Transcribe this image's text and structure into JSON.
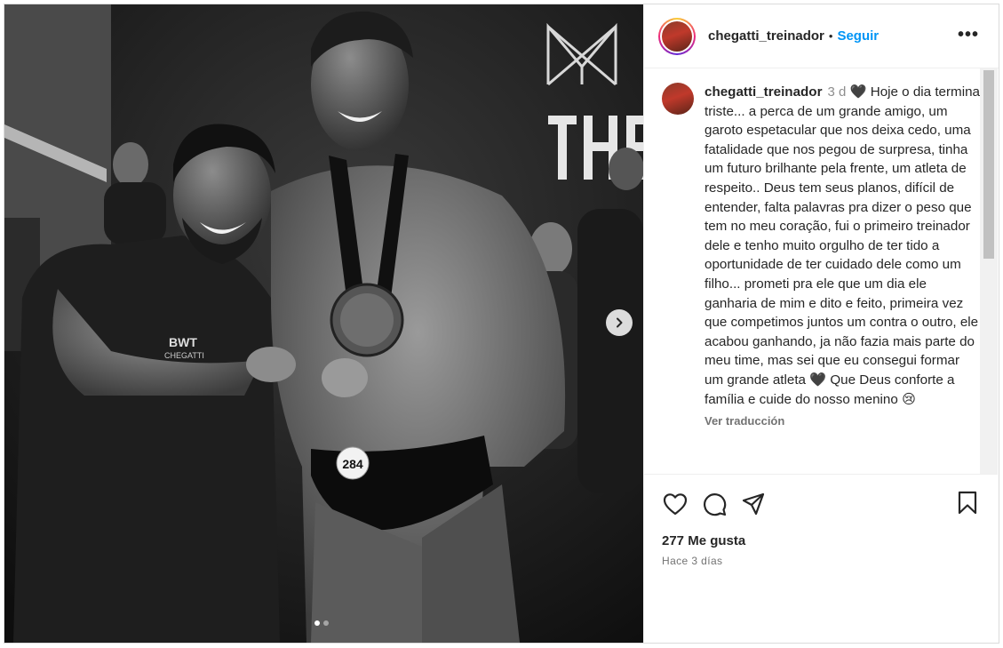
{
  "post": {
    "username": "chegatti_treinador",
    "separator": "•",
    "follow_label": "Seguir",
    "more_label": "•••",
    "photo_bib_number": "284",
    "carousel": {
      "slides": 2,
      "active": 1
    }
  },
  "caption": {
    "username": "chegatti_treinador",
    "time": "3 d",
    "text": "🖤 Hoje o dia termina triste... a perca de um grande amigo, um garoto espetacular que nos deixa cedo, uma fatalidade que nos pegou de surpresa, tinha um futuro brilhante pela frente, um atleta de respeito.. Deus tem seus planos, difícil de entender, falta palavras pra dizer o peso que tem no meu coração, fui o primeiro treinador dele e tenho muito orgulho de ter tido a oportunidade de ter cuidado dele como um filho... prometi pra ele que um dia ele ganharia de mim e dito e feito, primeira vez que competimos juntos um contra o outro, ele acabou ganhando, ja não fazia mais parte do meu time, mas sei que eu consegui formar um grande atleta 🖤 Que Deus conforte a família e cuide do nosso menino 😢",
    "translate_label": "Ver traducción"
  },
  "engagement": {
    "likes": "277 Me gusta",
    "ago": "Hace 3 días"
  },
  "icons": {
    "like": "heart-icon",
    "comment": "comment-icon",
    "share": "share-icon",
    "save": "bookmark-icon",
    "next": "chevron-right-icon"
  },
  "colors": {
    "accent": "#0095f6",
    "text": "#262626",
    "muted": "#737373"
  }
}
